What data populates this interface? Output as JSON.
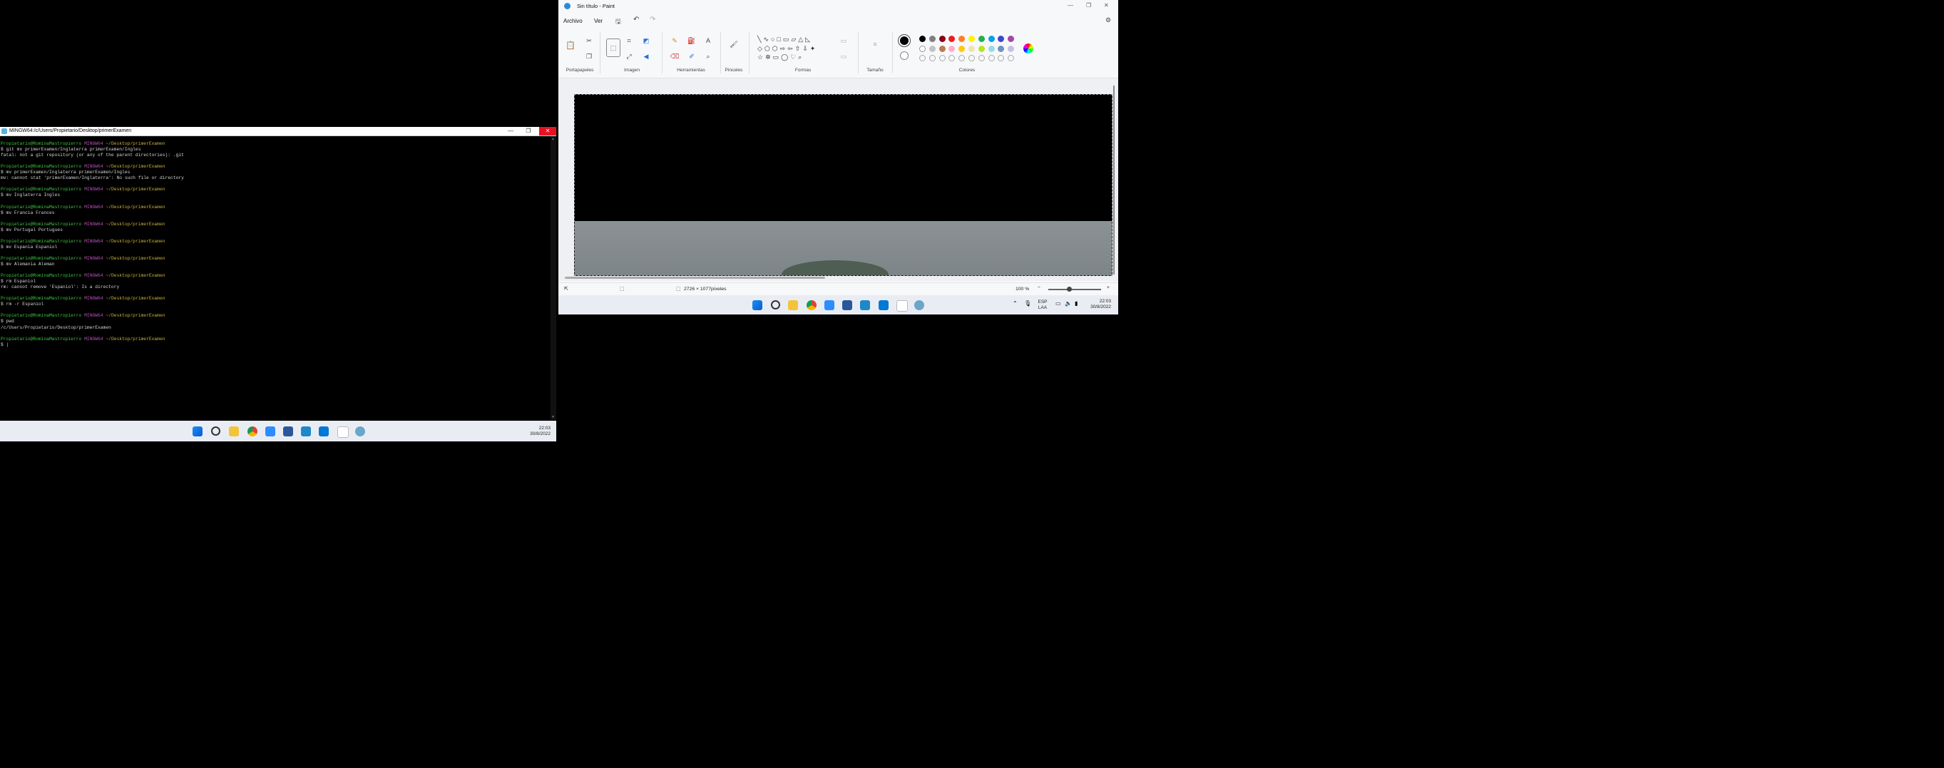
{
  "terminal": {
    "title": "MINGW64:/c/Users/Propietario/Desktop/primerExamen",
    "minimize": "—",
    "maximize": "❐",
    "close": "✕",
    "lines": [
      {
        "parts": [
          {
            "c": "g",
            "t": "Propietario@RominaMastropierro "
          },
          {
            "c": "m",
            "t": "MINGW64 "
          },
          {
            "c": "y",
            "t": "~/Desktop/primerExamen"
          }
        ]
      },
      {
        "parts": [
          {
            "c": "w",
            "t": "$ git mv primerExamen/Inglaterra primerExamen/Ingles"
          }
        ]
      },
      {
        "parts": [
          {
            "c": "w",
            "t": "fatal: not a git repository (or any of the parent directories): .git"
          }
        ]
      },
      {
        "parts": [
          {
            "c": "w",
            "t": ""
          }
        ]
      },
      {
        "parts": [
          {
            "c": "g",
            "t": "Propietario@RominaMastropierro "
          },
          {
            "c": "m",
            "t": "MINGW64 "
          },
          {
            "c": "y",
            "t": "~/Desktop/primerExamen"
          }
        ]
      },
      {
        "parts": [
          {
            "c": "w",
            "t": "$ mv primerExamen/Inglaterra primerExamen/Ingles"
          }
        ]
      },
      {
        "parts": [
          {
            "c": "w",
            "t": "mv: cannot stat 'primerExamen/Inglaterra': No such file or directory"
          }
        ]
      },
      {
        "parts": [
          {
            "c": "w",
            "t": ""
          }
        ]
      },
      {
        "parts": [
          {
            "c": "g",
            "t": "Propietario@RominaMastropierro "
          },
          {
            "c": "m",
            "t": "MINGW64 "
          },
          {
            "c": "y",
            "t": "~/Desktop/primerExamen"
          }
        ]
      },
      {
        "parts": [
          {
            "c": "w",
            "t": "$ mv Inglaterra Ingles"
          }
        ]
      },
      {
        "parts": [
          {
            "c": "w",
            "t": ""
          }
        ]
      },
      {
        "parts": [
          {
            "c": "g",
            "t": "Propietario@RominaMastropierro "
          },
          {
            "c": "m",
            "t": "MINGW64 "
          },
          {
            "c": "y",
            "t": "~/Desktop/primerExamen"
          }
        ]
      },
      {
        "parts": [
          {
            "c": "w",
            "t": "$ mv Francia Frances"
          }
        ]
      },
      {
        "parts": [
          {
            "c": "w",
            "t": ""
          }
        ]
      },
      {
        "parts": [
          {
            "c": "g",
            "t": "Propietario@RominaMastropierro "
          },
          {
            "c": "m",
            "t": "MINGW64 "
          },
          {
            "c": "y",
            "t": "~/Desktop/primerExamen"
          }
        ]
      },
      {
        "parts": [
          {
            "c": "w",
            "t": "$ mv Portugal Portugues"
          }
        ]
      },
      {
        "parts": [
          {
            "c": "w",
            "t": ""
          }
        ]
      },
      {
        "parts": [
          {
            "c": "g",
            "t": "Propietario@RominaMastropierro "
          },
          {
            "c": "m",
            "t": "MINGW64 "
          },
          {
            "c": "y",
            "t": "~/Desktop/primerExamen"
          }
        ]
      },
      {
        "parts": [
          {
            "c": "w",
            "t": "$ mv Espania Espaniol"
          }
        ]
      },
      {
        "parts": [
          {
            "c": "w",
            "t": ""
          }
        ]
      },
      {
        "parts": [
          {
            "c": "g",
            "t": "Propietario@RominaMastropierro "
          },
          {
            "c": "m",
            "t": "MINGW64 "
          },
          {
            "c": "y",
            "t": "~/Desktop/primerExamen"
          }
        ]
      },
      {
        "parts": [
          {
            "c": "w",
            "t": "$ mv Alemania Aleman"
          }
        ]
      },
      {
        "parts": [
          {
            "c": "w",
            "t": ""
          }
        ]
      },
      {
        "parts": [
          {
            "c": "g",
            "t": "Propietario@RominaMastropierro "
          },
          {
            "c": "m",
            "t": "MINGW64 "
          },
          {
            "c": "y",
            "t": "~/Desktop/primerExamen"
          }
        ]
      },
      {
        "parts": [
          {
            "c": "w",
            "t": "$ rm Espaniol"
          }
        ]
      },
      {
        "parts": [
          {
            "c": "w",
            "t": "rm: cannot remove 'Espaniol': Is a directory"
          }
        ]
      },
      {
        "parts": [
          {
            "c": "w",
            "t": ""
          }
        ]
      },
      {
        "parts": [
          {
            "c": "g",
            "t": "Propietario@RominaMastropierro "
          },
          {
            "c": "m",
            "t": "MINGW64 "
          },
          {
            "c": "y",
            "t": "~/Desktop/primerExamen"
          }
        ]
      },
      {
        "parts": [
          {
            "c": "w",
            "t": "$ rm -r Espaniol"
          }
        ]
      },
      {
        "parts": [
          {
            "c": "w",
            "t": ""
          }
        ]
      },
      {
        "parts": [
          {
            "c": "g",
            "t": "Propietario@RominaMastropierro "
          },
          {
            "c": "m",
            "t": "MINGW64 "
          },
          {
            "c": "y",
            "t": "~/Desktop/primerExamen"
          }
        ]
      },
      {
        "parts": [
          {
            "c": "w",
            "t": "$ pwd"
          }
        ]
      },
      {
        "parts": [
          {
            "c": "w",
            "t": "/c/Users/Propietario/Desktop/primerExamen"
          }
        ]
      },
      {
        "parts": [
          {
            "c": "w",
            "t": ""
          }
        ]
      },
      {
        "parts": [
          {
            "c": "g",
            "t": "Propietario@RominaMastropierro "
          },
          {
            "c": "m",
            "t": "MINGW64 "
          },
          {
            "c": "y",
            "t": "~/Desktop/primerExamen"
          }
        ]
      },
      {
        "parts": [
          {
            "c": "w",
            "t": "$ |"
          }
        ]
      }
    ]
  },
  "taskbar_left": {
    "time": "22:03",
    "date": "30/8/2022",
    "icons": [
      "windows-start-icon",
      "search-icon",
      "file-explorer-icon",
      "chrome-icon",
      "zoom-icon",
      "word-icon",
      "notepad-icon",
      "vscode-icon",
      "notes-app-icon",
      "git-bash-icon"
    ]
  },
  "paint": {
    "title": "Sin título - Paint",
    "menu": {
      "archivo": "Archivo",
      "ver": "Ver"
    },
    "groups": {
      "portapapeles": "Portapapeles",
      "imagen": "Imagen",
      "herramientas": "Herramientas",
      "pinceles": "Pinceles",
      "formas": "Formas",
      "tamano": "Tamaño",
      "colores": "Colores"
    },
    "colors": {
      "row1": [
        "#000000",
        "#7f7f7f",
        "#880015",
        "#ed1c24",
        "#ff7f27",
        "#fff200",
        "#22b14c",
        "#00a2e8",
        "#3f48cc",
        "#a349a4"
      ],
      "row2": [
        "#ffffff",
        "#c3c3c3",
        "#b97a57",
        "#ffaec9",
        "#ffc90e",
        "#efe4b0",
        "#b5e61d",
        "#99d9ea",
        "#7092be",
        "#c8bfe7"
      ]
    },
    "status": {
      "dimensions": "2726 × 1077píxeles",
      "zoom": "100 %"
    }
  },
  "taskbar_right": {
    "lang1": "ESP",
    "lang2": "LAA",
    "time": "22:03",
    "date": "30/8/2022"
  }
}
